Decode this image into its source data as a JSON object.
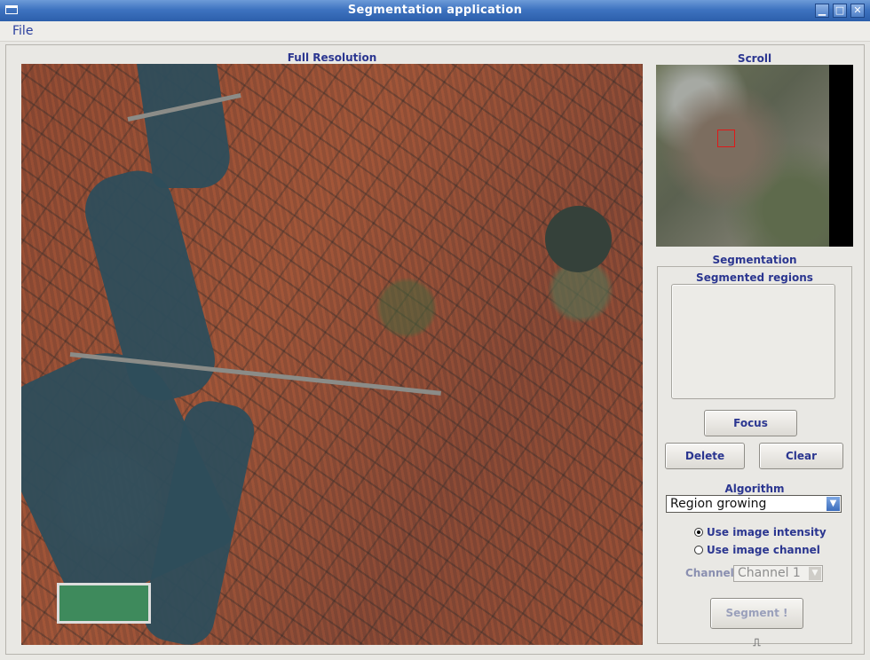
{
  "window": {
    "title": "Segmentation application",
    "minimize": "▁",
    "maximize": "□",
    "close": "✕"
  },
  "menu": {
    "file": "File"
  },
  "labels": {
    "full_resolution": "Full Resolution",
    "scroll": "Scroll",
    "segmentation": "Segmentation",
    "segmented_regions": "Segmented regions",
    "algorithm": "Algorithm",
    "channel": "Channel"
  },
  "buttons": {
    "focus": "Focus",
    "delete": "Delete",
    "clear": "Clear",
    "segment": "Segment !",
    "segment_icon": "⎍"
  },
  "algorithm_select": {
    "value": "Region growing",
    "arrow": "▼"
  },
  "radios": [
    {
      "label": "Use image intensity",
      "checked": true
    },
    {
      "label": "Use image channel",
      "checked": false
    }
  ],
  "channel_select": {
    "value": "Channel 1",
    "arrow": "▼",
    "enabled": false
  },
  "colors": {
    "title_bar": "#3e73c0",
    "label_text": "#2b3690",
    "roi": "#e01818"
  }
}
